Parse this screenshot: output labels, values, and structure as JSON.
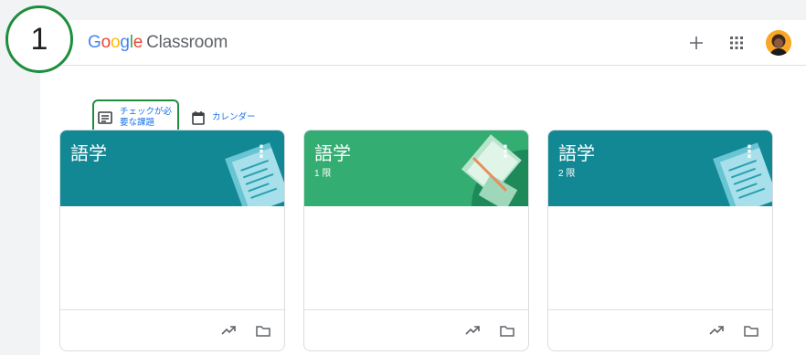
{
  "app": {
    "logo_word": "Google",
    "product_name": "Classroom"
  },
  "header": {
    "add_icon": "plus-icon",
    "apps_icon": "apps-grid-icon",
    "avatar_icon": "user-avatar"
  },
  "step_badge": "1",
  "subnav": {
    "todo_line1": "チェックが必",
    "todo_line2": "要な課題",
    "calendar_label": "カレンダー"
  },
  "classes": [
    {
      "title": "語学",
      "section": "",
      "color": "#128894"
    },
    {
      "title": "語学",
      "section": "1 限",
      "color": "#33ad72"
    },
    {
      "title": "語学",
      "section": "2 限",
      "color": "#128894"
    }
  ],
  "colors": {
    "accent_blue": "#1a73e8",
    "highlight_green": "#1e8e3e",
    "google_blue": "#4285f4",
    "google_red": "#ea4335",
    "google_yellow": "#fbbc05",
    "google_green": "#34a853"
  }
}
